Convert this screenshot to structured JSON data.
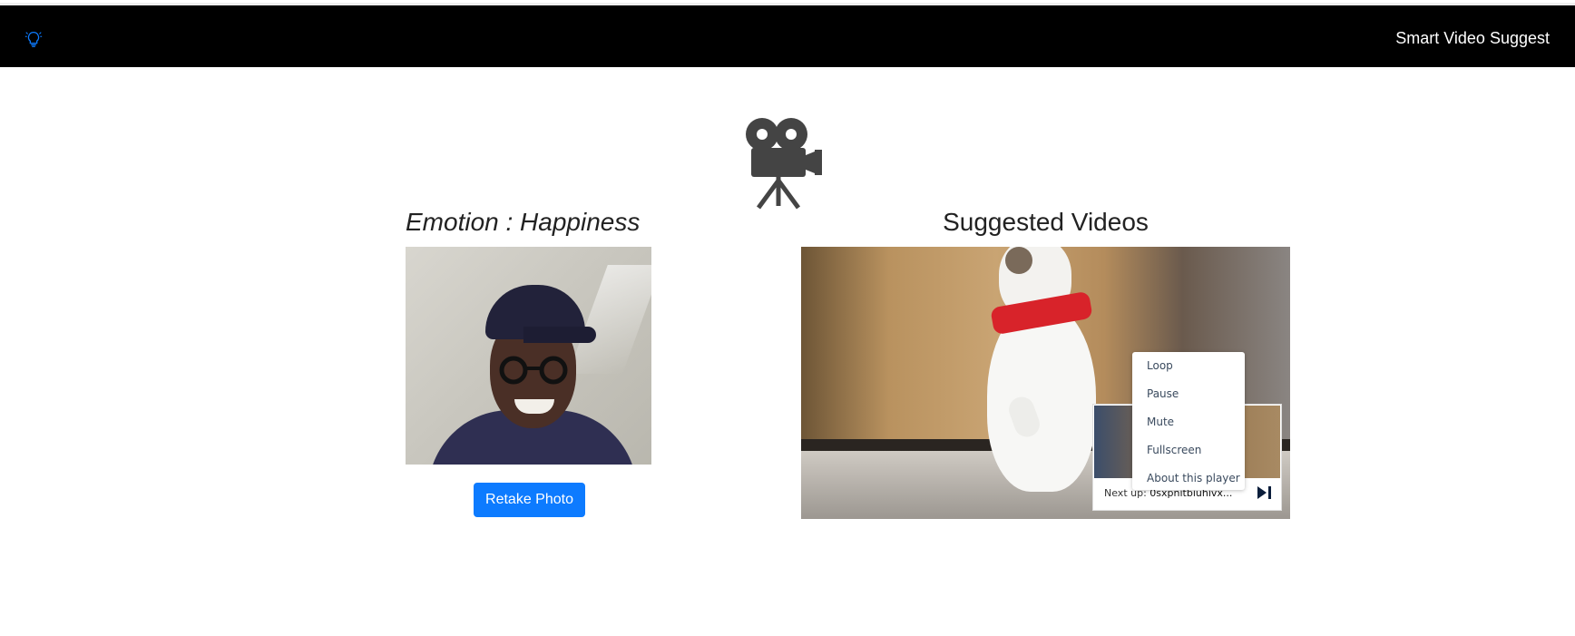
{
  "navbar": {
    "brand": "Smart Video Suggest",
    "logo_icon": "lightbulb-icon",
    "logo_color": "#0d7bff"
  },
  "hero": {
    "icon": "movie-camera-icon"
  },
  "emotion": {
    "label": "Emotion : Happiness"
  },
  "photo": {
    "retake_label": "Retake Photo",
    "button_color": "#0d7bff"
  },
  "suggestions": {
    "title": "Suggested Videos",
    "up_next_prefix": "Next up:",
    "up_next_title": "0sxpnitbiuhivx..."
  },
  "context_menu": {
    "items": [
      "Loop",
      "Pause",
      "Mute",
      "Fullscreen",
      "About this player"
    ]
  }
}
